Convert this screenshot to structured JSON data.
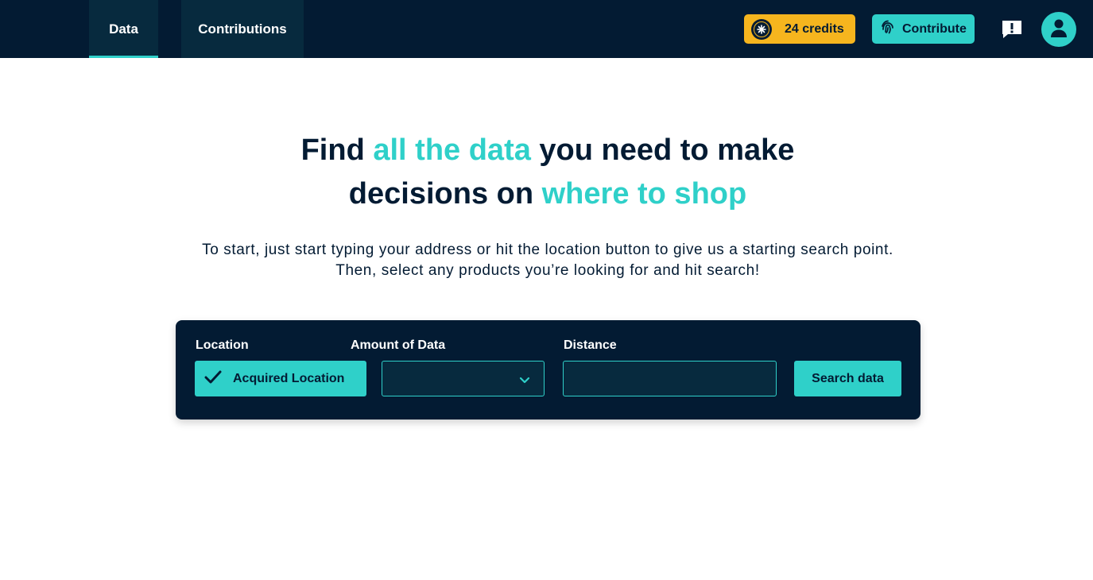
{
  "nav": {
    "tabs": [
      {
        "label": "Data",
        "active": true
      },
      {
        "label": "Contributions",
        "active": false
      }
    ],
    "credits_label": "24 credits",
    "contribute_label": "Contribute",
    "icons": {
      "credits": "coin-icon",
      "contribute": "fingerprint-icon",
      "feedback": "feedback-icon",
      "user": "user-icon"
    }
  },
  "hero": {
    "headline_part1": "Find ",
    "headline_accent1": "all the data",
    "headline_part2": " you need to make",
    "headline_part3": "decisions on ",
    "headline_accent2": "where to shop",
    "subtext_line1": "To start, just start typing your address or hit the location button to give us a starting search point.",
    "subtext_line2": "Then, select any products you’re looking for and hit search!"
  },
  "search": {
    "location_label": "Location",
    "location_button": "Acquired Location",
    "amount_label": "Amount of Data",
    "amount_value": "",
    "distance_label": "Distance",
    "distance_value": "",
    "search_button": "Search data"
  },
  "colors": {
    "navy": "#031b33",
    "teal": "#2fd0c9",
    "gold": "#f6b51e",
    "white": "#ffffff"
  }
}
